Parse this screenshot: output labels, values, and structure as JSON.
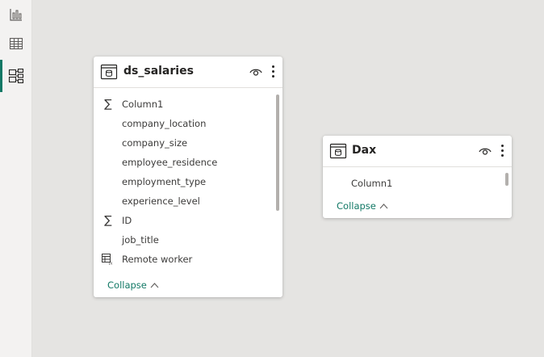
{
  "rail": {
    "items": [
      {
        "icon": "bar-chart-icon"
      },
      {
        "icon": "table-grid-icon"
      },
      {
        "icon": "model-view-icon",
        "active": true
      }
    ]
  },
  "tables": [
    {
      "title": "ds_salaries",
      "fields": [
        {
          "label": "Column1",
          "icon": "sigma-icon"
        },
        {
          "label": "company_location",
          "icon": ""
        },
        {
          "label": "company_size",
          "icon": ""
        },
        {
          "label": "employee_residence",
          "icon": ""
        },
        {
          "label": "employment_type",
          "icon": ""
        },
        {
          "label": "experience_level",
          "icon": ""
        },
        {
          "label": "ID",
          "icon": "sigma-icon"
        },
        {
          "label": "job_title",
          "icon": ""
        },
        {
          "label": "Remote worker",
          "icon": "calculated-column-icon"
        }
      ],
      "collapse_label": "Collapse"
    },
    {
      "title": "Dax",
      "fields": [
        {
          "label": "Column1",
          "icon": ""
        }
      ],
      "collapse_label": "Collapse"
    }
  ],
  "colors": {
    "accent": "#117865",
    "canvas": "#e5e4e2",
    "rail": "#f3f2f1"
  }
}
